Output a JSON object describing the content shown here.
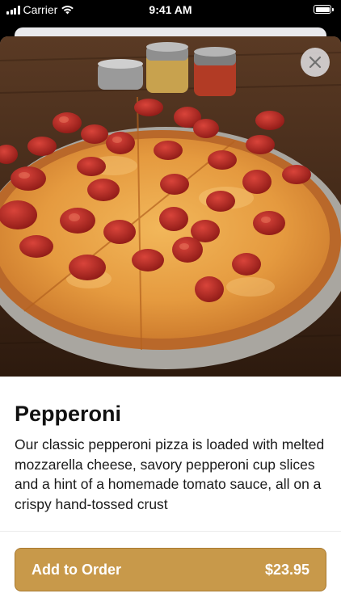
{
  "status_bar": {
    "carrier": "Carrier",
    "time": "9:41 AM"
  },
  "item": {
    "name": "Pepperoni",
    "description": "Our classic pepperoni pizza is loaded with melted mozzarella cheese, savory pepperoni cup slices and a hint of a homemade tomato sauce, all on a crispy hand-tossed crust",
    "image_icon": "pizza-photo"
  },
  "actions": {
    "close_icon": "close-icon",
    "add_label": "Add to Order",
    "price": "$23.95"
  },
  "colors": {
    "accent": "#c8994a",
    "accent_border": "#a97a32",
    "text": "#111111",
    "close_bg": "#e1e1e4"
  }
}
